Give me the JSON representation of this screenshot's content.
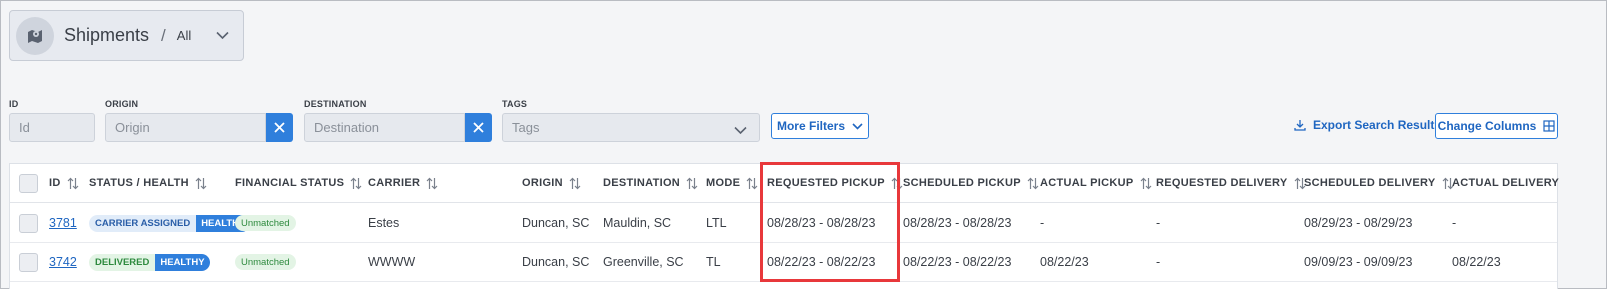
{
  "header": {
    "title": "Shipments",
    "separator": "/",
    "view": "All"
  },
  "filters": {
    "id": {
      "label": "ID",
      "placeholder": "Id",
      "value": ""
    },
    "origin": {
      "label": "ORIGIN",
      "placeholder": "Origin",
      "value": ""
    },
    "destination": {
      "label": "DESTINATION",
      "placeholder": "Destination",
      "value": ""
    },
    "tags": {
      "label": "TAGS",
      "placeholder": "Tags"
    },
    "more_filters_label": "More Filters",
    "export_label": "Export Search Result",
    "change_columns_label": "Change Columns"
  },
  "table": {
    "columns": [
      "ID",
      "STATUS / HEALTH",
      "FINANCIAL STATUS",
      "CARRIER",
      "ORIGIN",
      "DESTINATION",
      "MODE",
      "REQUESTED PICKUP",
      "SCHEDULED PICKUP",
      "ACTUAL PICKUP",
      "REQUESTED DELIVERY",
      "SCHEDULED DELIVERY",
      "ACTUAL DELIVERY"
    ],
    "rows": [
      {
        "id": "3781",
        "status": "CARRIER ASSIGNED",
        "health": "HEALTHY",
        "financial_status": "Unmatched",
        "carrier": "Estes",
        "origin": "Duncan, SC",
        "destination": "Mauldin, SC",
        "mode": "LTL",
        "requested_pickup": "08/28/23 - 08/28/23",
        "scheduled_pickup": "08/28/23 - 08/28/23",
        "actual_pickup": "-",
        "requested_delivery": "-",
        "scheduled_delivery": "08/29/23 - 08/29/23",
        "actual_delivery": "-"
      },
      {
        "id": "3742",
        "status": "DELIVERED",
        "health": "HEALTHY",
        "financial_status": "Unmatched",
        "carrier": "WWWW",
        "origin": "Duncan, SC",
        "destination": "Greenville, SC",
        "mode": "TL",
        "requested_pickup": "08/22/23 - 08/22/23",
        "scheduled_pickup": "08/22/23 - 08/22/23",
        "actual_pickup": "08/22/23",
        "requested_delivery": "-",
        "scheduled_delivery": "09/09/23 - 09/09/23",
        "actual_delivery": "08/22/23"
      }
    ]
  },
  "colors": {
    "accent": "#2f7fdc",
    "highlight": "#e8383b",
    "healthy_badge": "#2f7fdc",
    "unmatched_badge": "#e3f4e5"
  },
  "icons": {
    "header": "map-icon",
    "dropdown": "chevron-down-icon",
    "clear": "close-icon",
    "export": "download-icon",
    "columns": "grid-icon",
    "sort": "sort-icon"
  }
}
